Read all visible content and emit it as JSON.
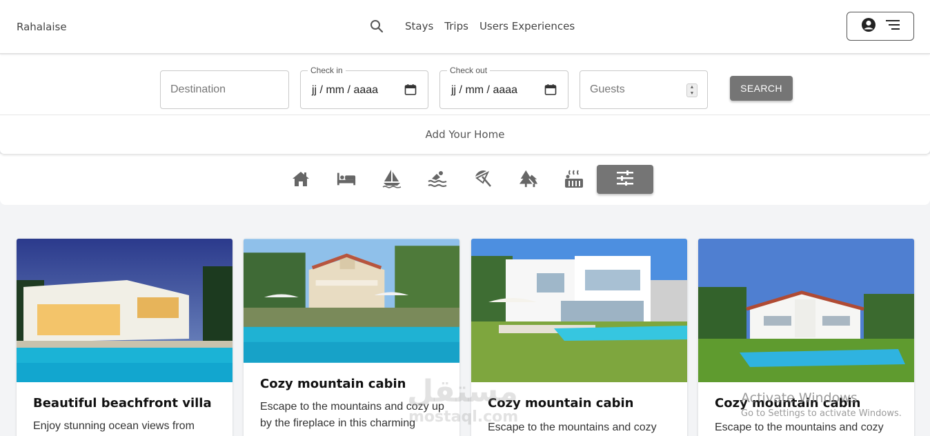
{
  "brand": "Rahalaise",
  "nav": {
    "links": [
      "Stays",
      "Trips",
      "Users Experiences"
    ]
  },
  "search": {
    "destination_placeholder": "Destination",
    "checkin_label": "Check in",
    "checkin_value": "jj / mm / aaaa",
    "checkout_label": "Check out",
    "checkout_value": "jj / mm / aaaa",
    "guests_placeholder": "Guests",
    "button_label": "SEARCH"
  },
  "add_home": "Add Your Home",
  "categories": [
    "home-icon",
    "bed-icon",
    "sailboat-icon",
    "pool-icon",
    "beach-umbrella-icon",
    "forest-icon",
    "hot-tub-icon",
    "filter-icon"
  ],
  "colors": {
    "accent_button": "#757575",
    "background": "#f3f4f6"
  },
  "cards": [
    {
      "title": "Beautiful beachfront villa",
      "desc": "Enjoy stunning ocean views from"
    },
    {
      "title": "Cozy mountain cabin",
      "desc": "Escape to the mountains and cozy up by the fireplace in this charming"
    },
    {
      "title": "Cozy mountain cabin",
      "desc": "Escape to the mountains and cozy"
    },
    {
      "title": "Cozy mountain cabin",
      "desc": "Escape to the mountains and cozy"
    }
  ],
  "watermark": {
    "arabic": "مستقل",
    "latin": "mostaql.com"
  },
  "os_notice": {
    "title": "Activate Windows",
    "subtitle": "Go to Settings to activate Windows."
  }
}
